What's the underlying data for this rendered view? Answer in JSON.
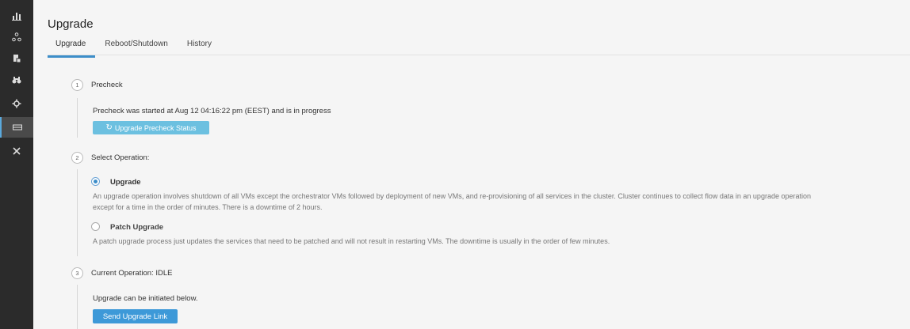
{
  "page": {
    "title": "Upgrade"
  },
  "sidebar": {
    "items": [
      {
        "icon": "bar-chart-icon"
      },
      {
        "icon": "topology-icon"
      },
      {
        "icon": "documents-icon"
      },
      {
        "icon": "binoculars-icon"
      },
      {
        "icon": "gear-icon"
      },
      {
        "icon": "server-icon",
        "active": true
      },
      {
        "icon": "tools-icon"
      }
    ],
    "colors": {
      "background": "#2b2b2b",
      "active": "#4a4a4a",
      "accent": "#5aa9dd"
    }
  },
  "tabs": [
    {
      "label": "Upgrade",
      "active": true
    },
    {
      "label": "Reboot/Shutdown"
    },
    {
      "label": "History"
    }
  ],
  "steps": {
    "precheck": {
      "number": "1",
      "title": "Precheck",
      "status_text": "Precheck was started at Aug 12 04:16:22 pm (EEST) and is in progress",
      "button_label": "Upgrade Precheck Status",
      "button_icon": "refresh-icon"
    },
    "select_operation": {
      "number": "2",
      "title": "Select Operation:",
      "options": [
        {
          "label": "Upgrade",
          "selected": true,
          "description_line1": "An upgrade operation involves shutdown of all VMs except the orchestrator VMs followed by deployment of new VMs, and re-provisioning of all services in the cluster. Cluster continues to collect flow data in an upgrade operation",
          "description_line2": "except for a time in the order of minutes. There is a downtime of 2 hours."
        },
        {
          "label": "Patch Upgrade",
          "selected": false,
          "description_line1": "A patch upgrade process just updates the services that need to be patched and will not result in restarting VMs. The downtime is usually in the order of few minutes."
        }
      ]
    },
    "current_operation": {
      "number": "3",
      "title": "Current Operation: IDLE",
      "info_text": "Upgrade can be initiated below.",
      "button_label": "Send Upgrade Link"
    }
  },
  "colors": {
    "accent": "#3d8ec9",
    "primary_button": "#3d99d8",
    "secondary_button": "#6cc0e0"
  }
}
